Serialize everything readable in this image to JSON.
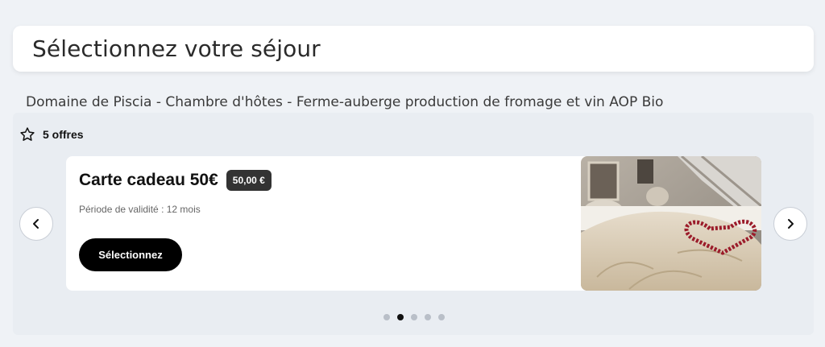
{
  "header": {
    "title": "Sélectionnez votre séjour"
  },
  "venue": {
    "name": "Domaine de Piscia - Chambre d'hôtes - Ferme-auberge production de fromage et vin AOP Bio"
  },
  "offers": {
    "count_label": "5 offres",
    "icon": "star-icon",
    "active_index": 1,
    "total": 5
  },
  "card": {
    "title": "Carte cadeau 50€",
    "price": "50,00 €",
    "validity": "Période de validité : 12 mois",
    "select_label": "Sélectionnez",
    "image_alt": "bed-with-rose-petal-heart"
  },
  "nav": {
    "prev_icon": "chevron-left-icon",
    "next_icon": "chevron-right-icon"
  }
}
